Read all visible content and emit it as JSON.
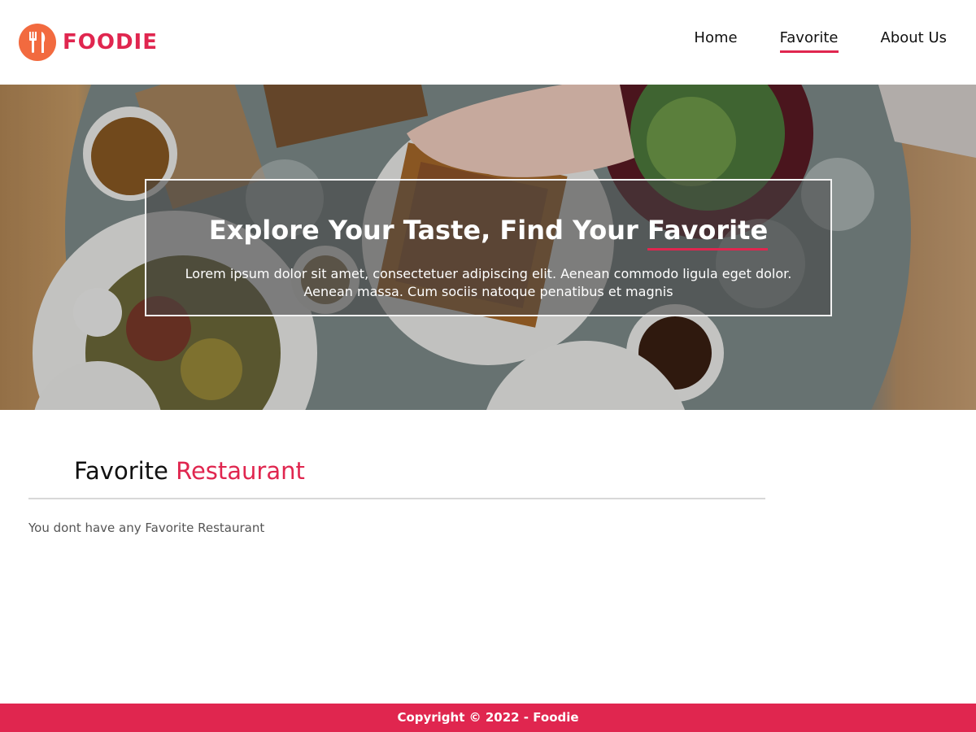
{
  "brand": {
    "name": "FOODIE",
    "logo_icon": "fork-knife-icon",
    "color": "#e0264f",
    "badge_color": "#f26a3f"
  },
  "nav": {
    "items": [
      {
        "label": "Home"
      },
      {
        "label": "Favorite",
        "active": true
      },
      {
        "label": "About Us"
      }
    ]
  },
  "hero": {
    "title_start": "Explore Your Taste, Find Your ",
    "title_highlight": "Favorite",
    "description": "Lorem ipsum dolor sit amet, consectetuer adipiscing elit. Aenean commodo ligula eget dolor. Aenean massa. Cum sociis natoque penatibus et magnis"
  },
  "section": {
    "title_start": "Favorite",
    "title_accent": "Restaurant",
    "empty_message": "You dont have any Favorite Restaurant"
  },
  "footer": {
    "text": "Copyright © 2022 - Foodie"
  }
}
